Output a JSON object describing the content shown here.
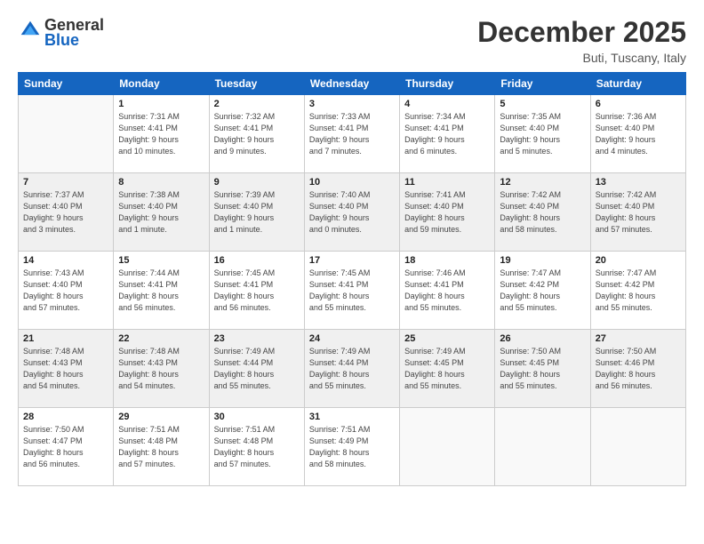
{
  "header": {
    "logo_general": "General",
    "logo_blue": "Blue",
    "month_title": "December 2025",
    "location": "Buti, Tuscany, Italy"
  },
  "weekdays": [
    "Sunday",
    "Monday",
    "Tuesday",
    "Wednesday",
    "Thursday",
    "Friday",
    "Saturday"
  ],
  "weeks": [
    [
      {
        "day": "",
        "info": ""
      },
      {
        "day": "1",
        "info": "Sunrise: 7:31 AM\nSunset: 4:41 PM\nDaylight: 9 hours\nand 10 minutes."
      },
      {
        "day": "2",
        "info": "Sunrise: 7:32 AM\nSunset: 4:41 PM\nDaylight: 9 hours\nand 9 minutes."
      },
      {
        "day": "3",
        "info": "Sunrise: 7:33 AM\nSunset: 4:41 PM\nDaylight: 9 hours\nand 7 minutes."
      },
      {
        "day": "4",
        "info": "Sunrise: 7:34 AM\nSunset: 4:41 PM\nDaylight: 9 hours\nand 6 minutes."
      },
      {
        "day": "5",
        "info": "Sunrise: 7:35 AM\nSunset: 4:40 PM\nDaylight: 9 hours\nand 5 minutes."
      },
      {
        "day": "6",
        "info": "Sunrise: 7:36 AM\nSunset: 4:40 PM\nDaylight: 9 hours\nand 4 minutes."
      }
    ],
    [
      {
        "day": "7",
        "info": "Sunrise: 7:37 AM\nSunset: 4:40 PM\nDaylight: 9 hours\nand 3 minutes."
      },
      {
        "day": "8",
        "info": "Sunrise: 7:38 AM\nSunset: 4:40 PM\nDaylight: 9 hours\nand 1 minute."
      },
      {
        "day": "9",
        "info": "Sunrise: 7:39 AM\nSunset: 4:40 PM\nDaylight: 9 hours\nand 1 minute."
      },
      {
        "day": "10",
        "info": "Sunrise: 7:40 AM\nSunset: 4:40 PM\nDaylight: 9 hours\nand 0 minutes."
      },
      {
        "day": "11",
        "info": "Sunrise: 7:41 AM\nSunset: 4:40 PM\nDaylight: 8 hours\nand 59 minutes."
      },
      {
        "day": "12",
        "info": "Sunrise: 7:42 AM\nSunset: 4:40 PM\nDaylight: 8 hours\nand 58 minutes."
      },
      {
        "day": "13",
        "info": "Sunrise: 7:42 AM\nSunset: 4:40 PM\nDaylight: 8 hours\nand 57 minutes."
      }
    ],
    [
      {
        "day": "14",
        "info": "Sunrise: 7:43 AM\nSunset: 4:40 PM\nDaylight: 8 hours\nand 57 minutes."
      },
      {
        "day": "15",
        "info": "Sunrise: 7:44 AM\nSunset: 4:41 PM\nDaylight: 8 hours\nand 56 minutes."
      },
      {
        "day": "16",
        "info": "Sunrise: 7:45 AM\nSunset: 4:41 PM\nDaylight: 8 hours\nand 56 minutes."
      },
      {
        "day": "17",
        "info": "Sunrise: 7:45 AM\nSunset: 4:41 PM\nDaylight: 8 hours\nand 55 minutes."
      },
      {
        "day": "18",
        "info": "Sunrise: 7:46 AM\nSunset: 4:41 PM\nDaylight: 8 hours\nand 55 minutes."
      },
      {
        "day": "19",
        "info": "Sunrise: 7:47 AM\nSunset: 4:42 PM\nDaylight: 8 hours\nand 55 minutes."
      },
      {
        "day": "20",
        "info": "Sunrise: 7:47 AM\nSunset: 4:42 PM\nDaylight: 8 hours\nand 55 minutes."
      }
    ],
    [
      {
        "day": "21",
        "info": "Sunrise: 7:48 AM\nSunset: 4:43 PM\nDaylight: 8 hours\nand 54 minutes."
      },
      {
        "day": "22",
        "info": "Sunrise: 7:48 AM\nSunset: 4:43 PM\nDaylight: 8 hours\nand 54 minutes."
      },
      {
        "day": "23",
        "info": "Sunrise: 7:49 AM\nSunset: 4:44 PM\nDaylight: 8 hours\nand 55 minutes."
      },
      {
        "day": "24",
        "info": "Sunrise: 7:49 AM\nSunset: 4:44 PM\nDaylight: 8 hours\nand 55 minutes."
      },
      {
        "day": "25",
        "info": "Sunrise: 7:49 AM\nSunset: 4:45 PM\nDaylight: 8 hours\nand 55 minutes."
      },
      {
        "day": "26",
        "info": "Sunrise: 7:50 AM\nSunset: 4:45 PM\nDaylight: 8 hours\nand 55 minutes."
      },
      {
        "day": "27",
        "info": "Sunrise: 7:50 AM\nSunset: 4:46 PM\nDaylight: 8 hours\nand 56 minutes."
      }
    ],
    [
      {
        "day": "28",
        "info": "Sunrise: 7:50 AM\nSunset: 4:47 PM\nDaylight: 8 hours\nand 56 minutes."
      },
      {
        "day": "29",
        "info": "Sunrise: 7:51 AM\nSunset: 4:48 PM\nDaylight: 8 hours\nand 57 minutes."
      },
      {
        "day": "30",
        "info": "Sunrise: 7:51 AM\nSunset: 4:48 PM\nDaylight: 8 hours\nand 57 minutes."
      },
      {
        "day": "31",
        "info": "Sunrise: 7:51 AM\nSunset: 4:49 PM\nDaylight: 8 hours\nand 58 minutes."
      },
      {
        "day": "",
        "info": ""
      },
      {
        "day": "",
        "info": ""
      },
      {
        "day": "",
        "info": ""
      }
    ]
  ]
}
